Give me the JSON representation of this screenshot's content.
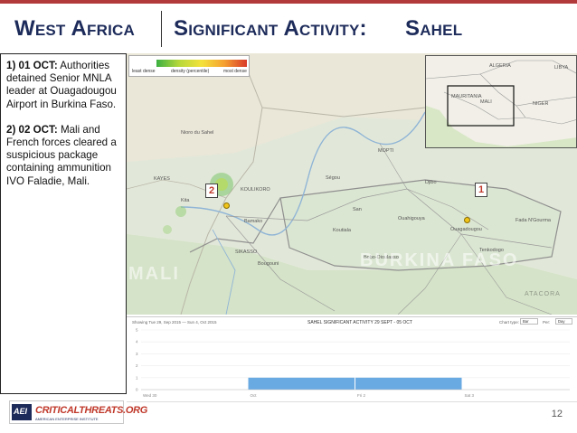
{
  "header": {
    "region": "West Africa",
    "topic": "Significant Activity:",
    "area": "Sahel"
  },
  "colors": {
    "title": "#1d2b5a",
    "top_rule": "#b23a3a",
    "marker_label": "#c0392b",
    "event_dot": "#f0c419",
    "chart_bar": "#6aaae3"
  },
  "panel": {
    "item1_num": "1) 01 OCT:",
    "item1_text": "Authorities detained Senior MNLA leader at Ouagadougou Airport in Burkina Faso.",
    "item2_num": "2) 02 OCT:",
    "item2_text": "Mali and French forces cleared a suspicious package containing ammunition IVO Faladie, Mali."
  },
  "legend": {
    "least": "least dense",
    "mid": "density (percentile)",
    "most": "most dense"
  },
  "map": {
    "markers": [
      {
        "label": "2",
        "place": "Bamako"
      },
      {
        "label": "1",
        "place": "Ouagadougou"
      }
    ],
    "country_labels": {
      "burkina": "BURKINA FASO",
      "mali_fragment": "MALI"
    },
    "place_labels": {
      "nioro": "Nioro du Sahel",
      "kayes": "KAYES",
      "koulikoro": "KOULIKORO",
      "bamako": "Bamako",
      "sikasso": "SIKASSO",
      "segou": "Ségou",
      "mopti": "MOPTI",
      "koutiala": "Koutiala",
      "ouagadougou": "Ouagadougou",
      "bobo": "Bobo-Dioulasso",
      "ouahigouya": "Ouahigouya",
      "djibo": "Djibo",
      "tenkodogo": "Tenkodogo",
      "fada": "Fada N'Gourma",
      "atacora": "ATACORA",
      "bougouni": "Bougouni",
      "kita": "Kita",
      "san": "San"
    },
    "inset_labels": {
      "algeria": "ALGERIA",
      "libya": "LIBYA",
      "mali": "MALI",
      "mauritania": "MAURITANIA",
      "niger": "NIGER"
    }
  },
  "chart": {
    "range_label": "Showing Tue 29, Sep 2015 — Sun 4, Oct 2015",
    "title": "SAHEL SIGNIFICANT ACTIVITY 29 SEPT - 05 OCT",
    "chart_type_label": "Chart type:",
    "chart_type_value": "Bar",
    "per_label": "Per:",
    "per_value": "Day"
  },
  "chart_data": {
    "type": "bar",
    "title": "SAHEL SIGNIFICANT ACTIVITY 29 SEPT - 05 OCT",
    "categories": [
      "Wed 30",
      "Oct",
      "Fri 2",
      "Sat 3"
    ],
    "values": [
      0,
      1,
      1,
      0
    ],
    "y_ticks": [
      "5",
      "4",
      "3",
      "2",
      "1",
      "0"
    ],
    "ylim": [
      0,
      5
    ],
    "grid": true
  },
  "footer": {
    "logo_aei": "AEI",
    "logo_ct": "CRITICALTHREATS.ORG",
    "logo_sub": "AMERICAN ENTERPRISE INSTITUTE",
    "page_number": "12"
  }
}
